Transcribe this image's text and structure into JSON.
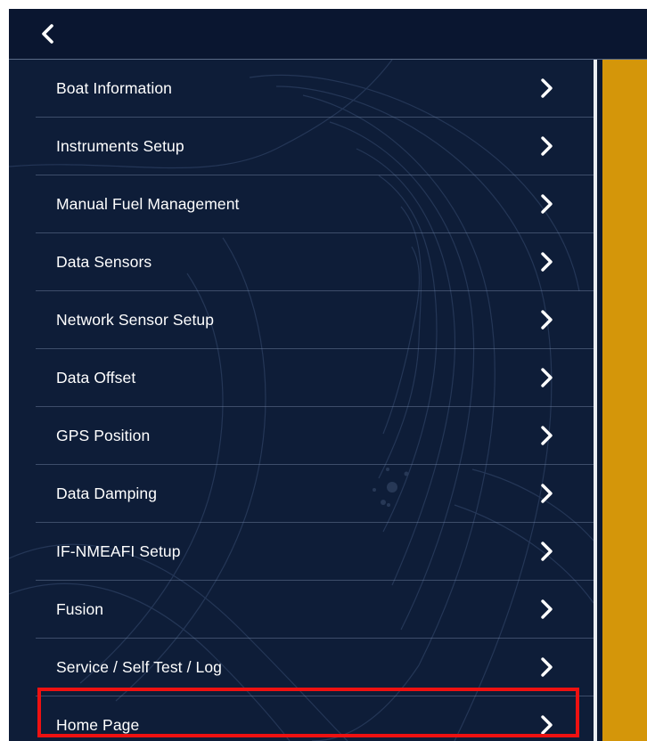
{
  "topbar": {
    "back_icon": "chevron-left-icon"
  },
  "menu": {
    "items": [
      {
        "label": "Boat Information",
        "icon": "chevron-right-icon"
      },
      {
        "label": "Instruments Setup",
        "icon": "chevron-right-icon"
      },
      {
        "label": "Manual Fuel Management",
        "icon": "chevron-right-icon"
      },
      {
        "label": "Data Sensors",
        "icon": "chevron-right-icon"
      },
      {
        "label": "Network Sensor Setup",
        "icon": "chevron-right-icon"
      },
      {
        "label": "Data Offset",
        "icon": "chevron-right-icon"
      },
      {
        "label": "GPS Position",
        "icon": "chevron-right-icon"
      },
      {
        "label": "Data Damping",
        "icon": "chevron-right-icon"
      },
      {
        "label": "IF-NMEAFI Setup",
        "icon": "chevron-right-icon"
      },
      {
        "label": "Fusion",
        "icon": "chevron-right-icon"
      },
      {
        "label": "Service / Self Test / Log",
        "icon": "chevron-right-icon",
        "highlighted": true
      },
      {
        "label": "Home Page",
        "icon": "chevron-right-icon"
      }
    ]
  },
  "colors": {
    "background": "#0c1a33",
    "menu_background": "#0e1d38",
    "side_panel": "#d4960a",
    "highlight": "#ee1111",
    "text": "#ffffff"
  }
}
